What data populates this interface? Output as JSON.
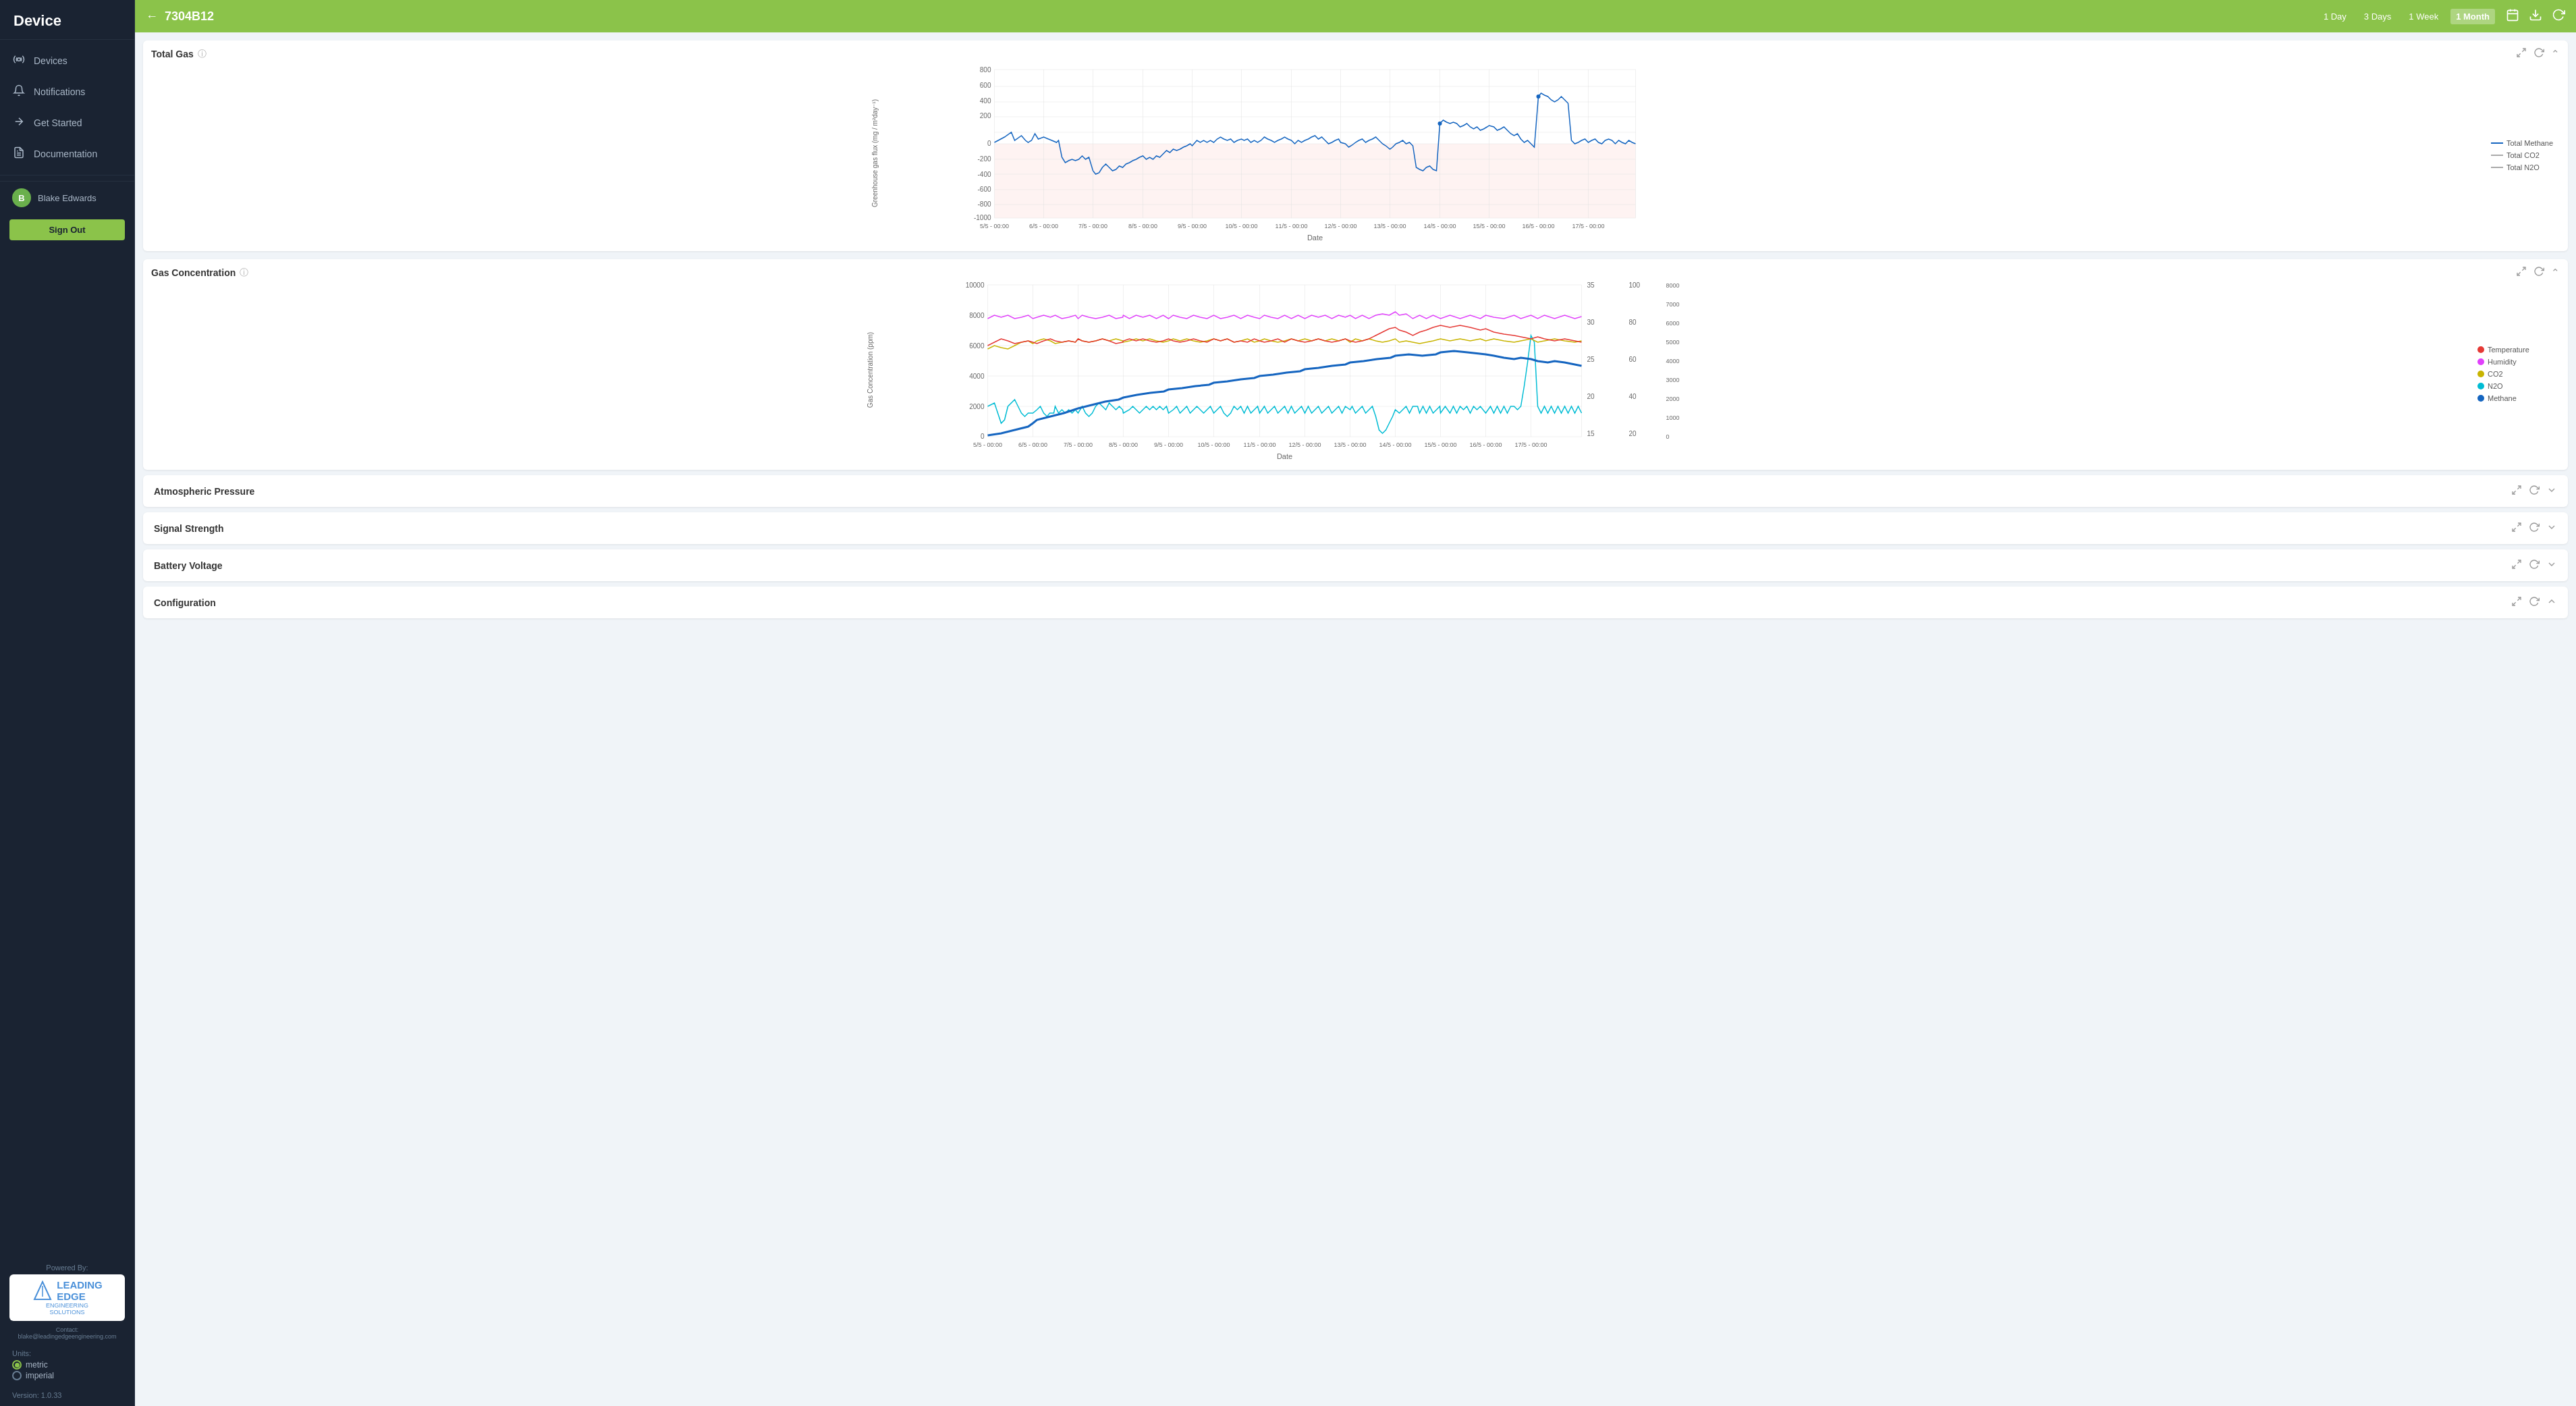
{
  "sidebar": {
    "title": "Device",
    "nav_items": [
      {
        "id": "devices",
        "label": "Devices",
        "icon": "📡"
      },
      {
        "id": "notifications",
        "label": "Notifications",
        "icon": "🔔"
      },
      {
        "id": "get-started",
        "label": "Get Started",
        "icon": "✈"
      },
      {
        "id": "documentation",
        "label": "Documentation",
        "icon": "📋"
      }
    ],
    "user": {
      "name": "Blake Edwards",
      "initials": "B"
    },
    "sign_out_label": "Sign Out",
    "powered_by": "Powered By:",
    "logo_main": "LEADING\nEDGE",
    "logo_sub": "ENGINEERING\nSOLUTIONS",
    "logo_contact": "Contact: blake@leadingedgeengineering.com",
    "units_label": "Units:",
    "units": [
      {
        "id": "metric",
        "label": "metric",
        "active": true
      },
      {
        "id": "imperial",
        "label": "imperial",
        "active": false
      }
    ],
    "version": "Version: 1.0.33"
  },
  "topbar": {
    "device_id": "7304B12",
    "back_icon": "←",
    "time_ranges": [
      {
        "id": "1day",
        "label": "1 Day",
        "active": false
      },
      {
        "id": "3days",
        "label": "3 Days",
        "active": false
      },
      {
        "id": "1week",
        "label": "1 Week",
        "active": false
      },
      {
        "id": "1month",
        "label": "1 Month",
        "active": true
      }
    ]
  },
  "charts": {
    "total_gas": {
      "title": "Total Gas",
      "y_label": "Greenhouse gas flux (mg / m²day⁻¹)",
      "x_label": "Date",
      "y_ticks": [
        "800",
        "600",
        "400",
        "200",
        "0",
        "-200",
        "-400",
        "-600",
        "-800",
        "-1000"
      ],
      "x_ticks": [
        "5/5 - 00:00",
        "6/5 - 00:00",
        "7/5 - 00:00",
        "8/5 - 00:00",
        "9/5 - 00:00",
        "10/5 - 00:00",
        "11/5 - 00:00",
        "12/5 - 00:00",
        "13/5 - 00:00",
        "14/5 - 00:00",
        "15/5 - 00:00",
        "16/5 - 00:00",
        "17/5 - 00:00"
      ],
      "legend": [
        {
          "label": "Total Methane",
          "color": "#1565c0",
          "type": "line"
        },
        {
          "label": "Total CO2",
          "color": "#aaa",
          "type": "line"
        },
        {
          "label": "Total N2O",
          "color": "#aaa",
          "type": "line"
        }
      ]
    },
    "gas_concentration": {
      "title": "Gas Concentration",
      "y_label": "Gas Concentration (ppm)",
      "x_label": "Date",
      "y_ticks": [
        "10000",
        "8000",
        "6000",
        "4000",
        "2000",
        "0"
      ],
      "x_ticks": [
        "5/5 - 00:00",
        "6/5 - 00:00",
        "7/5 - 00:00",
        "8/5 - 00:00",
        "9/5 - 00:00",
        "10/5 - 00:00",
        "11/5 - 00:00",
        "12/5 - 00:00",
        "13/5 - 00:00",
        "14/5 - 00:00",
        "15/5 - 00:00",
        "16/5 - 00:00",
        "17/5 - 00:00"
      ],
      "y2_temp_ticks": [
        "35",
        "30",
        "25",
        "20",
        "15"
      ],
      "y2_humid_ticks": [
        "100",
        "80",
        "60",
        "40",
        "20"
      ],
      "y2_co2_ticks": [
        "8000",
        "7000",
        "6000",
        "5000",
        "4000",
        "3000",
        "2000",
        "1000",
        "0"
      ],
      "y2_n2o_ticks": [
        "0",
        "1000",
        "2000",
        "3000",
        "4000",
        "5000",
        "6000",
        "7000",
        "8000"
      ],
      "legend": [
        {
          "label": "Temperature",
          "color": "#e53935",
          "type": "line"
        },
        {
          "label": "Humidity",
          "color": "#e040fb",
          "type": "line"
        },
        {
          "label": "CO2",
          "color": "#c8b400",
          "type": "line"
        },
        {
          "label": "N2O",
          "color": "#00bcd4",
          "type": "line"
        },
        {
          "label": "Methane",
          "color": "#1565c0",
          "type": "line"
        }
      ]
    }
  },
  "collapsed_panels": [
    {
      "id": "atmospheric-pressure",
      "title": "Atmospheric Pressure"
    },
    {
      "id": "signal-strength",
      "title": "Signal Strength"
    },
    {
      "id": "battery-voltage",
      "title": "Battery Voltage"
    },
    {
      "id": "configuration",
      "title": "Configuration"
    }
  ]
}
